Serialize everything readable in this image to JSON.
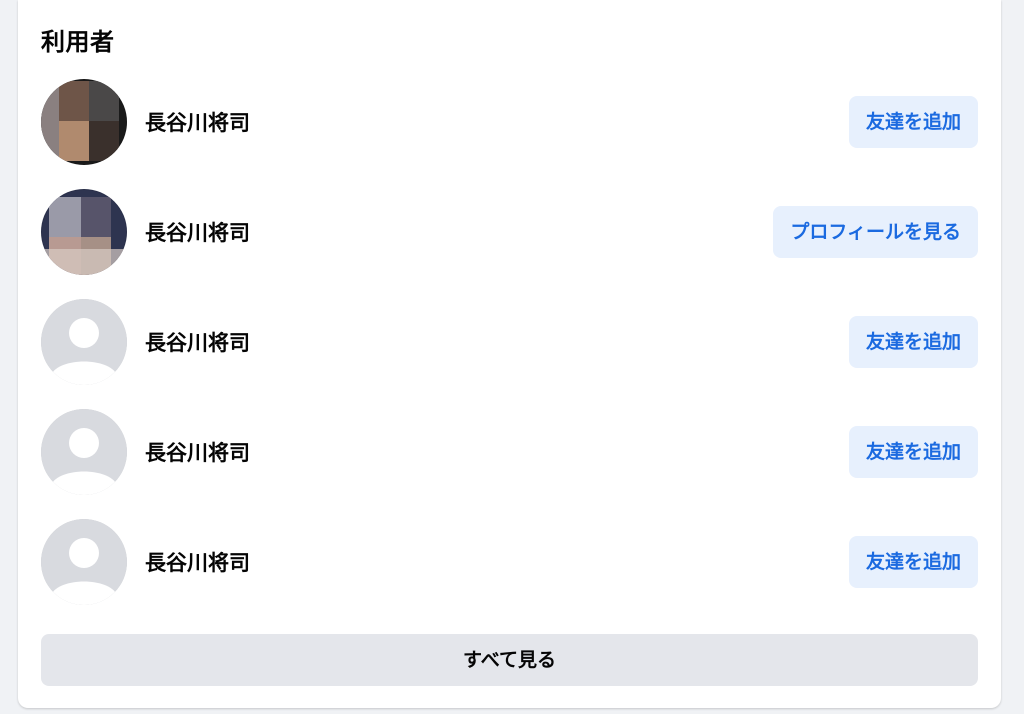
{
  "section": {
    "title": "利用者"
  },
  "users": [
    {
      "name": "長谷川将司",
      "action_label": "友達を追加",
      "avatar": "photo-blurred-1"
    },
    {
      "name": "長谷川将司",
      "action_label": "プロフィールを見る",
      "avatar": "photo-blurred-2"
    },
    {
      "name": "長谷川将司",
      "action_label": "友達を追加",
      "avatar": "default-avatar-icon"
    },
    {
      "name": "長谷川将司",
      "action_label": "友達を追加",
      "avatar": "default-avatar-icon"
    },
    {
      "name": "長谷川将司",
      "action_label": "友達を追加",
      "avatar": "default-avatar-icon"
    }
  ],
  "footer": {
    "see_all_label": "すべて見る"
  },
  "colors": {
    "action_button_bg": "#e7f0fd",
    "action_button_text": "#1b6ae0",
    "see_all_bg": "#e4e6eb",
    "page_bg": "#f0f2f5"
  }
}
